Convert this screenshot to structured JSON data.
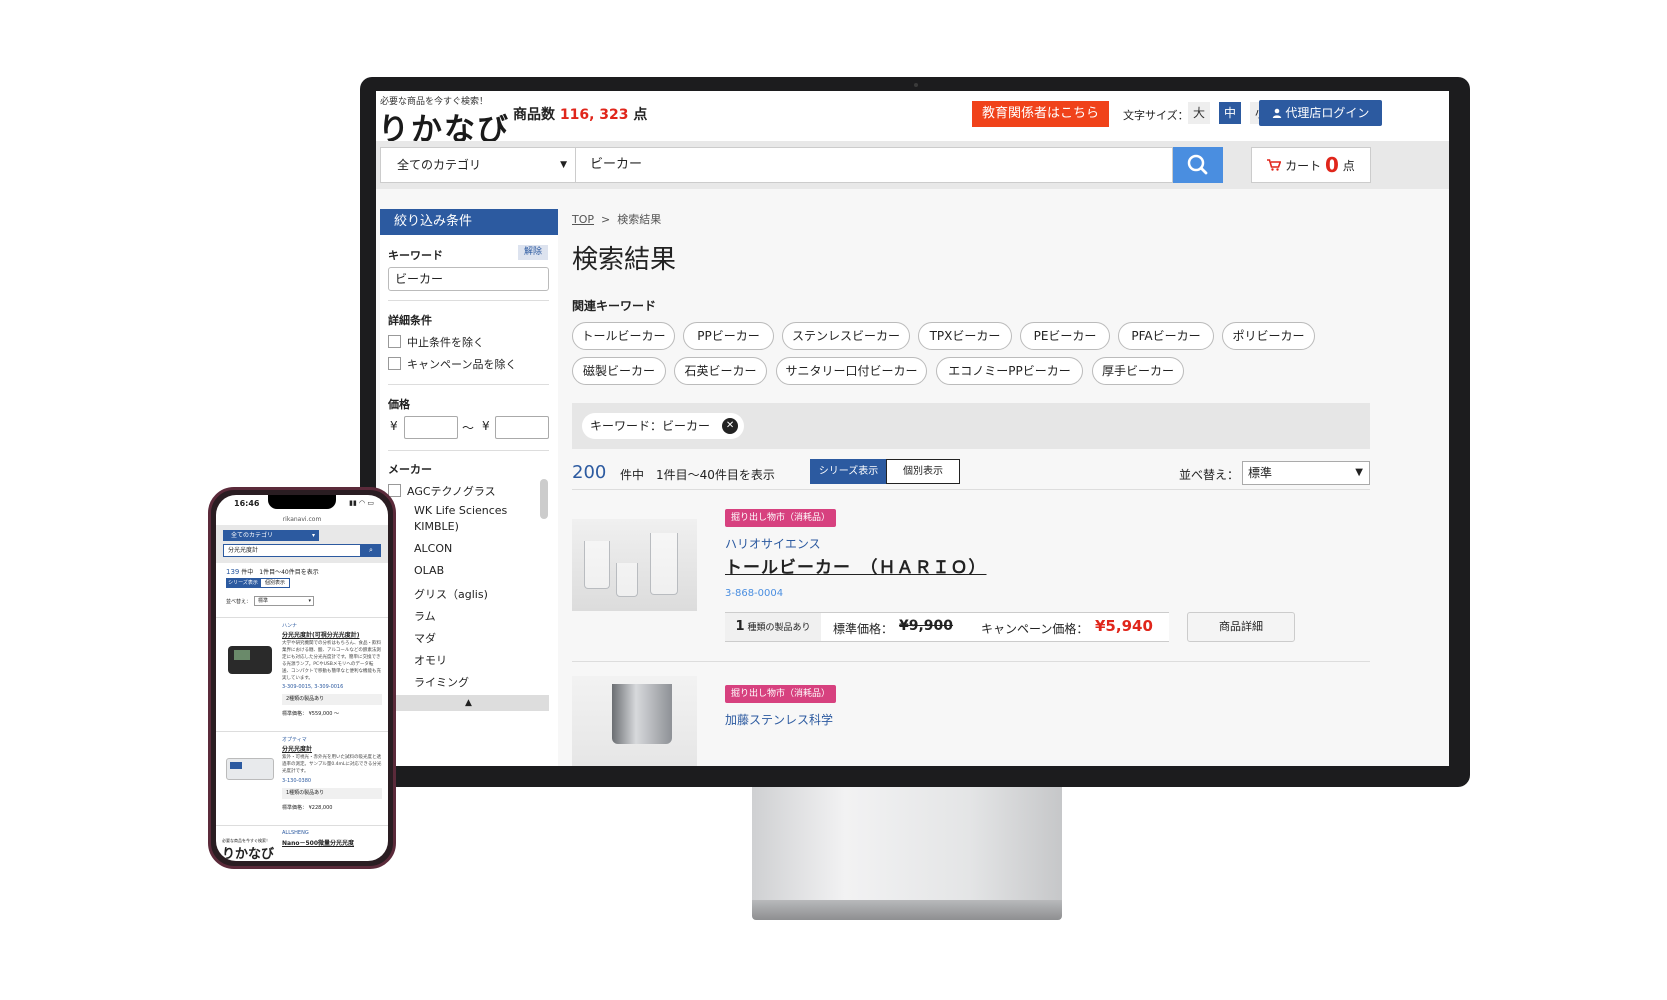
{
  "header": {
    "tagline": "必要な商品を今すぐ検索！",
    "logo": "りかなび",
    "count_prefix": "商品数",
    "count_value": "116, 323",
    "count_suffix": "点",
    "edu_button": "教育関係者はこちら",
    "font_size_label": "文字サイズ：",
    "font_sizes": [
      "大",
      "中",
      "小"
    ],
    "agent_login": "代理店ログイン"
  },
  "search": {
    "category": "全てのカテゴリ",
    "query": "ビーカー",
    "cart_label": "カート",
    "cart_count": "0",
    "cart_unit": "点"
  },
  "sidebar": {
    "title": "絞り込み条件",
    "keyword_label": "キーワード",
    "clear_label": "解除",
    "keyword_value": "ビーカー",
    "detail_label": "詳細条件",
    "detail_options": [
      "中止条件を除く",
      "キャンペーン品を除く"
    ],
    "price_label": "価格",
    "yen": "¥",
    "tilde": "〜",
    "maker_label": "メーカー",
    "makers": [
      "AGCテクノグラス",
      "WK Life Sciences",
      "KIMBLE)",
      "ALCON",
      "OLAB",
      "グリス（aglis)",
      "ラム",
      "マダ",
      "オモリ",
      "ライミング"
    ]
  },
  "main": {
    "breadcrumb_top": "TOP",
    "breadcrumb_sep": ">",
    "breadcrumb_current": "検索結果",
    "title": "検索結果",
    "related_label": "関連キーワード",
    "related": [
      "トールビーカー",
      "PPビーカー",
      "ステンレスビーカー",
      "TPXビーカー",
      "PEビーカー",
      "PFAビーカー",
      "ポリビーカー",
      "磁製ビーカー",
      "石英ビーカー",
      "サニタリー口付ビーカー",
      "エコノミーPPビーカー",
      "厚手ビーカー"
    ],
    "active_filter": "キーワード：ビーカー",
    "result_count": "200",
    "result_text": "件中　1件目〜40件目を表示",
    "view_series": "シリーズ表示",
    "view_single": "個別表示",
    "sort_label": "並べ替え：",
    "sort_value": "標準"
  },
  "products": [
    {
      "tag": "掘り出し物市（消耗品）",
      "maker": "ハリオサイエンス",
      "name": "トールビーカー　（ＨＡＲＩＯ）",
      "code": "3-868-0004",
      "variants_num": "1",
      "variants_text": "種類の製品あり",
      "std_label": "標準価格：",
      "std_price": "¥9,900",
      "camp_label": "キャンペーン価格：",
      "camp_price": "¥5,940",
      "detail_button": "商品詳細"
    },
    {
      "tag": "掘り出し物市（消耗品）",
      "maker": "加藤ステンレス科学"
    }
  ],
  "phone": {
    "time": "16:46",
    "url": "rikanavi.com",
    "category": "全てのカテゴリ",
    "query": "分光光度計",
    "count": "139",
    "count_text": "件中　1件目〜40件目を表示",
    "view_series": "シリーズ表示",
    "view_single": "個別表示",
    "sort_label": "並べ替え：",
    "sort_value": "標準",
    "items": [
      {
        "maker": "ハンナ",
        "title": "分光光度計(可視分光光度計)",
        "desc": "大学や研究機関での分析はもちろん、食品・飲料業界における糖、酸、アルコールなどの酵素法測定にも対応した分光光度計です。簡単に交換できる光源ランプ。PCやUSBメモリへのデータ転送、コンパクトで移動も簡単なと便利な機能も充実しています。",
        "codes": "3-309-0015, 3-309-0016",
        "variants": "2種類の製品あり",
        "price": "標準価格： ¥559,000 〜"
      },
      {
        "maker": "オプティマ",
        "title": "分光光度計",
        "desc": "紫外・可視光・赤外光を用いた試料の吸光度と透過率の測定。サンプル量0.4mLに対応できる分光光度計です。",
        "codes": "3-130-0380",
        "variants": "1種類の製品あり",
        "price": "標準価格： ¥228,000"
      },
      {
        "maker": "ALLSHENG",
        "title": "Nano－500微量分光光度"
      }
    ],
    "logo_tag": "必要な商品を今すぐ検索！",
    "logo": "りかなび"
  }
}
